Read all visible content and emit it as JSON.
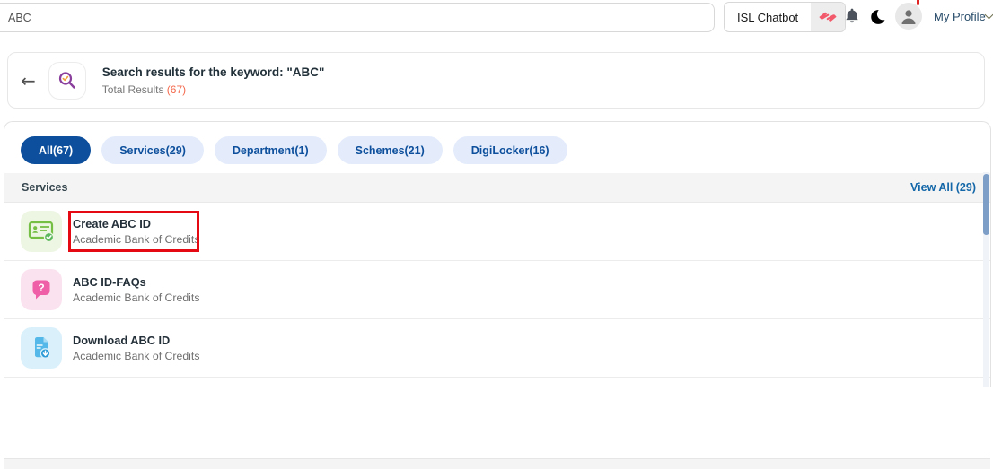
{
  "topbar": {
    "search_value": "ABC",
    "isl_chatbot": "ISL Chatbot",
    "my_profile": "My Profile"
  },
  "results_header": {
    "title": "Search results for the keyword: \"ABC\"",
    "total_label": "Total Results ",
    "total_count": "(67)"
  },
  "filters": [
    {
      "label": "All(67)",
      "active": true
    },
    {
      "label": "Services(29)",
      "active": false
    },
    {
      "label": "Department(1)",
      "active": false
    },
    {
      "label": "Schemes(21)",
      "active": false
    },
    {
      "label": "DigiLocker(16)",
      "active": false
    }
  ],
  "services": {
    "header": "Services",
    "view_all": "View All (29)",
    "items": [
      {
        "title": "Create ABC ID",
        "subtitle": "Academic Bank of Credits",
        "icon": "abc-id-card-icon",
        "highlighted": true
      },
      {
        "title": "ABC ID-FAQs",
        "subtitle": "Academic Bank of Credits",
        "icon": "faq-question-bubble-icon",
        "highlighted": false
      },
      {
        "title": "Download ABC ID",
        "subtitle": "Academic Bank of Credits",
        "icon": "download-document-icon",
        "highlighted": false
      }
    ]
  },
  "colors": {
    "active_pill_bg": "#0d4f9c",
    "pill_bg": "#e4ecfb",
    "pill_text": "#0d4f9c",
    "view_all_link": "#1467a8",
    "total_count": "#f4694c",
    "highlight_box": "#e50914",
    "isl_hands_icon": "#f25a6b",
    "search_magnifier": "#8a3f9d",
    "magnifier_check": "#f0a23c",
    "scroll_thumb": "#7d9ec7",
    "icon_green": "#76bf45",
    "icon_pink": "#ef5fa7",
    "icon_blue": "#54b9e9"
  }
}
